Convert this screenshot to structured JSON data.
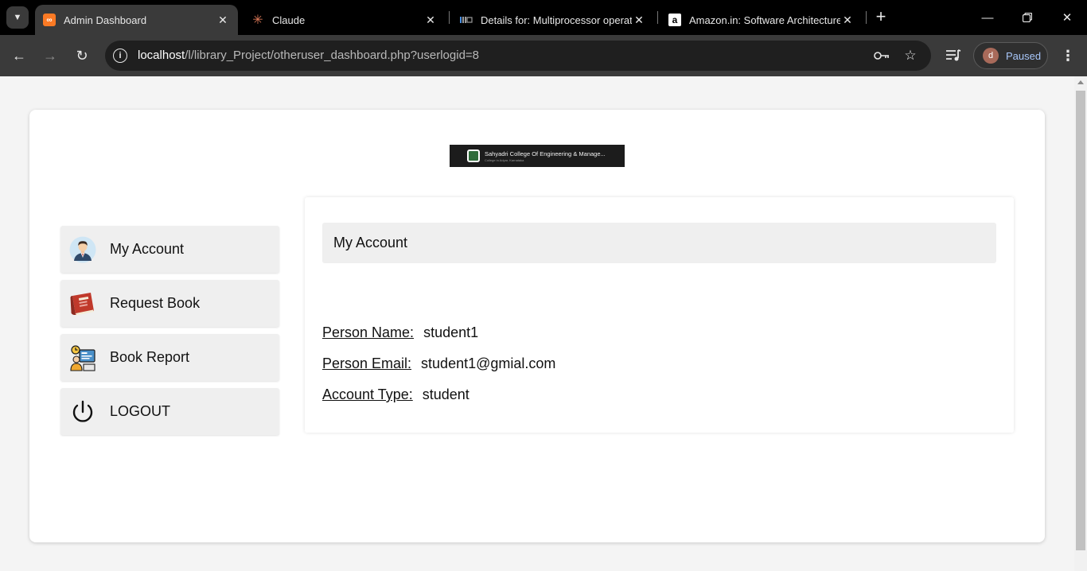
{
  "browser": {
    "tabs": [
      {
        "title": "Admin Dashboard",
        "favicon": "xampp-icon",
        "active": true
      },
      {
        "title": "Claude",
        "favicon": "claude-icon",
        "active": false
      },
      {
        "title": "Details for: Multiprocessor operati",
        "favicon": "catalog-icon",
        "active": false
      },
      {
        "title": "Amazon.in: Software Architecture:",
        "favicon": "amazon-icon",
        "active": false
      }
    ],
    "url_host": "localhost",
    "url_path": "/l/library_Project/otheruser_dashboard.php?userlogid=8",
    "profile_initial": "d",
    "profile_status": "Paused",
    "colors": {
      "chrome_bg": "#000000",
      "toolbar_bg": "#3a3a3a",
      "paused_text": "#a8c7fa"
    }
  },
  "page": {
    "banner": {
      "title": "Sahyadri College Of Engineering & Manage...",
      "subtitle": "College in Adyar, Karnataka"
    },
    "menu": [
      {
        "label": "My Account",
        "icon": "user-avatar-icon"
      },
      {
        "label": "Request Book",
        "icon": "book-icon"
      },
      {
        "label": "Book Report",
        "icon": "report-icon"
      },
      {
        "label": "LOGOUT",
        "icon": "power-icon"
      }
    ],
    "panel": {
      "title": "My Account",
      "fields": [
        {
          "label": "Person Name:",
          "value": "student1"
        },
        {
          "label": "Person Email:",
          "value": "student1@gmial.com"
        },
        {
          "label": "Account Type:",
          "value": "student"
        }
      ]
    }
  }
}
